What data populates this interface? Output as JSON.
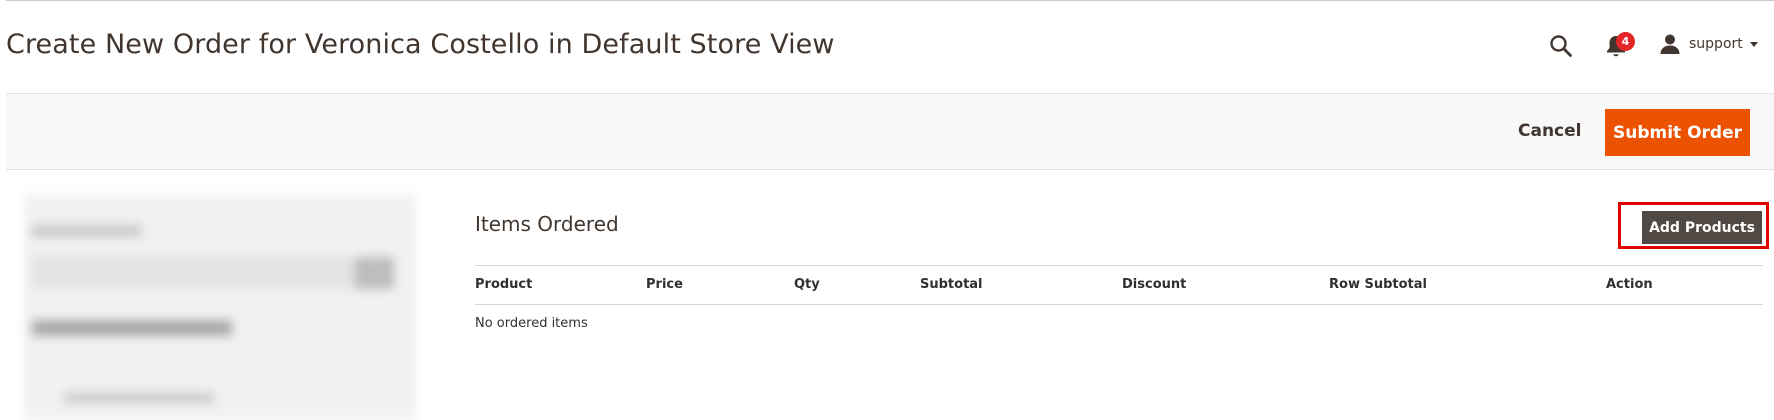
{
  "header": {
    "title": "Create New Order for Veronica Costello in Default Store View",
    "notifications_count": "4",
    "user_name": "support",
    "icons": [
      "search-icon",
      "bell-icon",
      "user-icon",
      "caret-down-icon"
    ]
  },
  "action_bar": {
    "cancel_label": "Cancel",
    "submit_label": "Submit Order"
  },
  "items_ordered": {
    "title": "Items Ordered",
    "add_products_label": "Add Products",
    "columns": [
      "Product",
      "Price",
      "Qty",
      "Subtotal",
      "Discount",
      "Row Subtotal",
      "Action"
    ],
    "empty_message": "No ordered items"
  },
  "colors": {
    "accent": "#eb5202",
    "dark_button": "#514943",
    "badge": "#e22626",
    "highlight": "#e00000",
    "text": "#41362f"
  }
}
